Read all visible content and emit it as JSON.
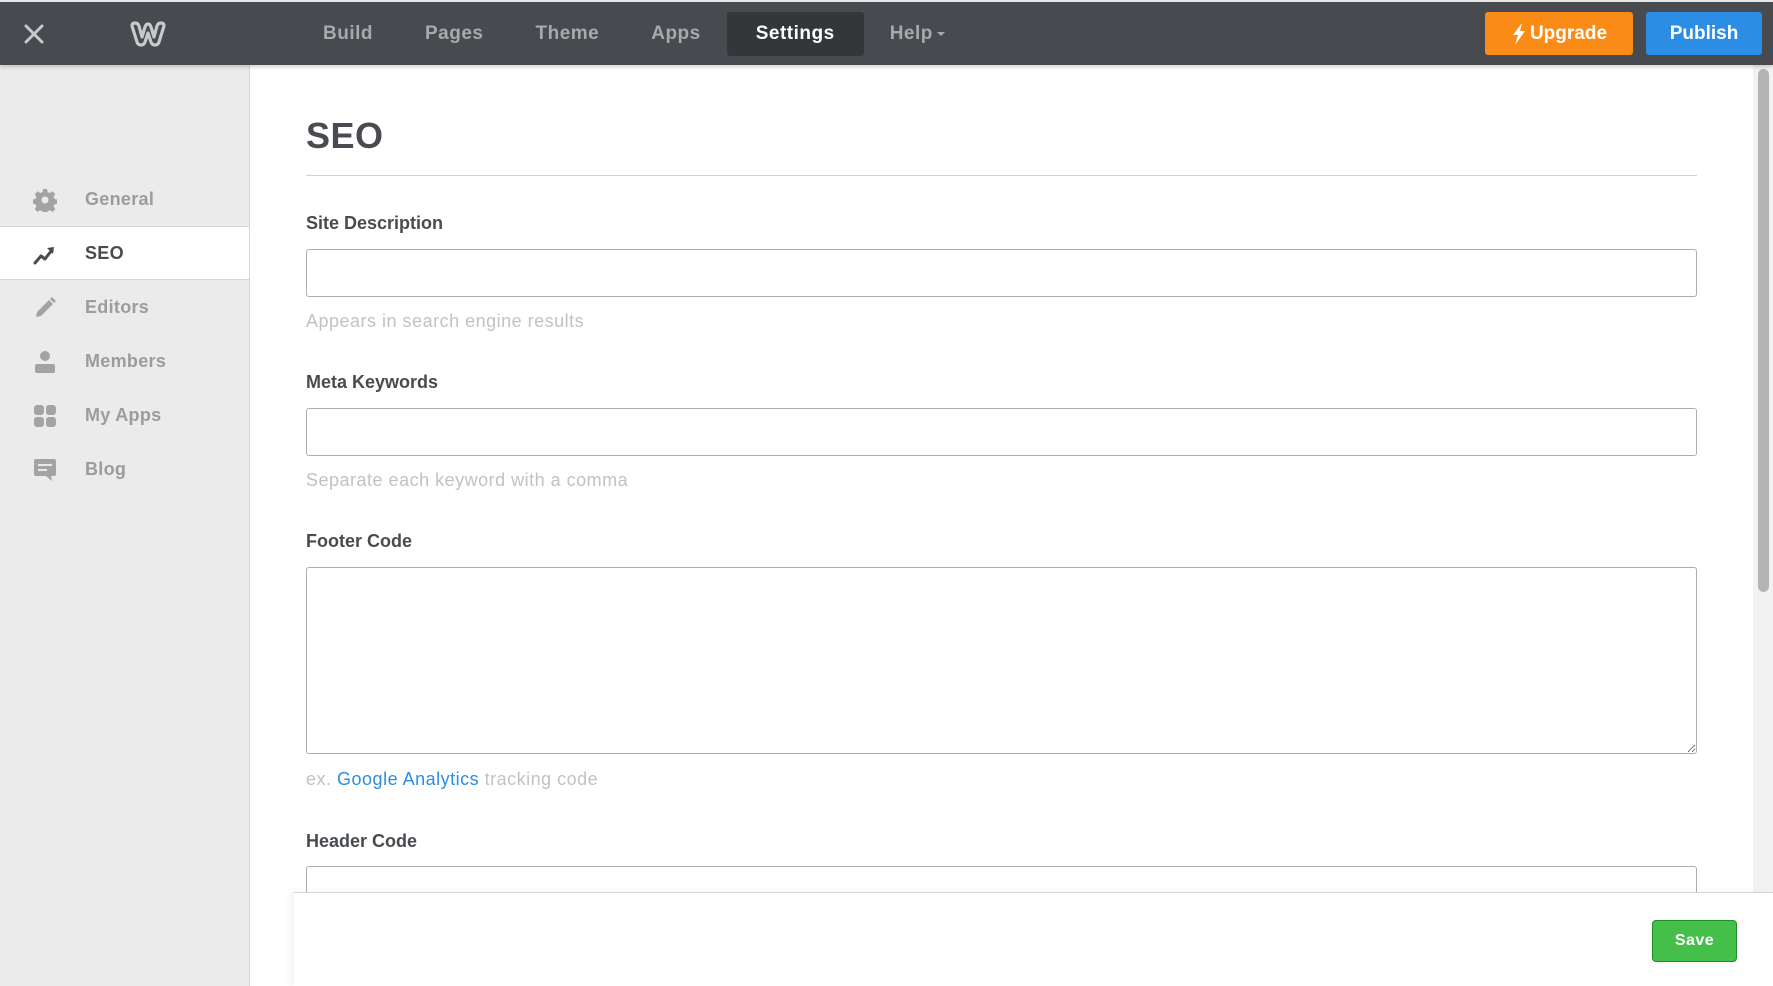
{
  "topbar": {
    "close_icon": "close-icon",
    "logo_icon": "weebly-logo-icon",
    "nav": [
      {
        "label": "Build",
        "active": false
      },
      {
        "label": "Pages",
        "active": false
      },
      {
        "label": "Theme",
        "active": false
      },
      {
        "label": "Apps",
        "active": false
      },
      {
        "label": "Settings",
        "active": true
      },
      {
        "label": "Help",
        "active": false,
        "dropdown": true
      }
    ],
    "upgrade_label": "Upgrade",
    "upgrade_icon": "lightning-icon",
    "publish_label": "Publish",
    "colors": {
      "bar": "#474b4f",
      "upgrade": "#fa8b16",
      "publish": "#2b8de3"
    }
  },
  "sidebar": {
    "items": [
      {
        "label": "General",
        "icon": "gear-icon",
        "active": false
      },
      {
        "label": "SEO",
        "icon": "trend-up-icon",
        "active": true
      },
      {
        "label": "Editors",
        "icon": "pencil-icon",
        "active": false
      },
      {
        "label": "Members",
        "icon": "person-icon",
        "active": false
      },
      {
        "label": "My Apps",
        "icon": "apps-grid-icon",
        "active": false
      },
      {
        "label": "Blog",
        "icon": "comment-icon",
        "active": false
      }
    ]
  },
  "main": {
    "title": "SEO",
    "fields": {
      "site_description": {
        "label": "Site Description",
        "value": "",
        "hint": "Appears in search engine results"
      },
      "meta_keywords": {
        "label": "Meta Keywords",
        "value": "",
        "hint": "Separate each keyword with a comma"
      },
      "footer_code": {
        "label": "Footer Code",
        "value": "",
        "hint_prefix": "ex.",
        "hint_link": "Google Analytics",
        "hint_suffix": "tracking code"
      },
      "header_code": {
        "label": "Header Code",
        "value": ""
      }
    }
  },
  "footer": {
    "save_label": "Save",
    "save_color": "#44bf4a"
  }
}
